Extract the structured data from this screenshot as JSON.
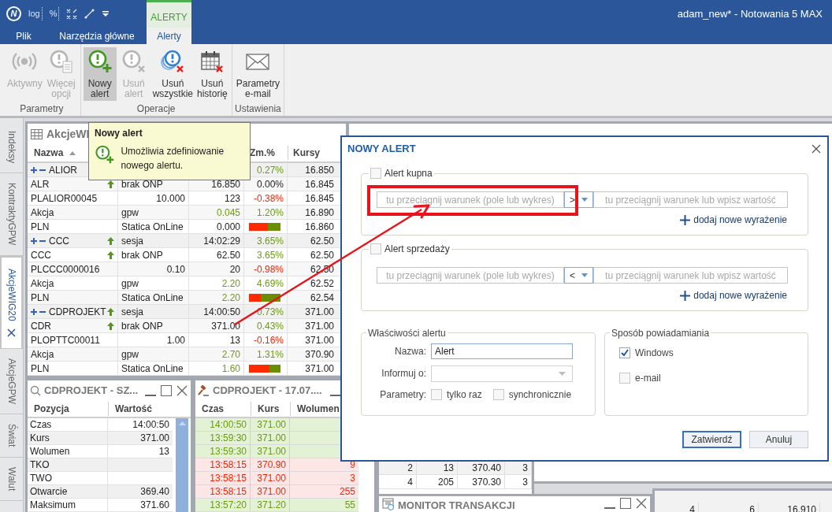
{
  "title_bar": {
    "quick_access": [
      {
        "kind": "logo",
        "label": "N"
      },
      {
        "kind": "scale",
        "label": "log"
      },
      {
        "kind": "scale",
        "label": "%"
      },
      {
        "kind": "cross"
      },
      {
        "kind": "line"
      },
      {
        "kind": "dropdown"
      }
    ],
    "context_tab": "ALERTY",
    "title": "adam_new* - Notowania 5 MAX"
  },
  "tabs": [
    {
      "label": "Plik",
      "selected": false
    },
    {
      "label": "Narzędzia główne",
      "selected": false
    },
    {
      "label": "Alerty",
      "selected": true
    }
  ],
  "ribbon": {
    "groups": [
      {
        "label": "Parametry",
        "buttons": [
          {
            "lines": [
              "Aktywny"
            ],
            "disabled": true,
            "selected": false
          },
          {
            "lines": [
              "Więcej",
              "opcji"
            ],
            "disabled": true,
            "selected": false
          }
        ]
      },
      {
        "label": "Operacje",
        "buttons": [
          {
            "lines": [
              "Nowy",
              "alert"
            ],
            "disabled": false,
            "selected": true
          },
          {
            "lines": [
              "Usuń",
              "alert"
            ],
            "disabled": true,
            "selected": false
          },
          {
            "lines": [
              "Usuń",
              "wszystkie"
            ],
            "disabled": false,
            "selected": false
          },
          {
            "lines": [
              "Usuń",
              "historię"
            ],
            "disabled": false,
            "selected": false
          }
        ]
      },
      {
        "label": "Ustawienia",
        "buttons": [
          {
            "lines": [
              "Parametry",
              "e-mail"
            ],
            "disabled": false,
            "selected": false
          }
        ]
      }
    ]
  },
  "side_tabs": [
    {
      "label": "Indeksy",
      "selected": false
    },
    {
      "label": "KontraktyGPW",
      "selected": false
    },
    {
      "label": "AkcjeWIG20",
      "selected": true
    },
    {
      "label": "AkcjeGPW",
      "selected": false
    },
    {
      "label": "Świat",
      "selected": false
    },
    {
      "label": "Walut",
      "selected": false
    }
  ],
  "main_panel": {
    "title": "AkcjeWI",
    "columns": [
      {
        "label": "Nazwa",
        "sorted": true
      },
      {
        "label": "Zm.%"
      },
      {
        "label": "Kursy"
      }
    ],
    "rows": [
      {
        "kind": "group",
        "name": "ALIOR",
        "arrow": false,
        "change": "0.27%",
        "change_up": true,
        "change_down": false,
        "price": "16.850"
      },
      {
        "kind": "symbol",
        "name": "ALR",
        "arrow": true,
        "col2": "brak ONP",
        "col3": "16.850",
        "col3_up": false,
        "change": "0.00%",
        "change_up": false,
        "change_down": false,
        "price": "16.845"
      },
      {
        "kind": "isin",
        "name": "PLALIOR00045",
        "arrow": false,
        "col2": "10.000",
        "col3": "123",
        "col3_up": false,
        "change": "-0.38%",
        "change_up": false,
        "change_down": true,
        "price": "16.845"
      },
      {
        "kind": "type",
        "name": "Akcja",
        "arrow": false,
        "col2": "gpw",
        "col3": "0.045",
        "col3_up": true,
        "change": "1.20%",
        "change_up": true,
        "change_down": false,
        "price": "16.890"
      },
      {
        "kind": "currency",
        "name": "PLN",
        "arrow": false,
        "col2": "Statica OnLine",
        "col3": "0.000",
        "col3_up": false,
        "bar": {
          "level": 0.6
        },
        "price": "16.860"
      },
      {
        "kind": "group",
        "name": "CCC",
        "arrow": true,
        "col2": "sesja",
        "col3": "14:02:29",
        "col3_up": false,
        "change": "3.65%",
        "change_up": true,
        "change_down": false,
        "price": "62.50"
      },
      {
        "kind": "symbol",
        "name": "CCC",
        "arrow": true,
        "col2": "brak ONP",
        "col3": "62.50",
        "col3_up": false,
        "change": "3.65%",
        "change_up": true,
        "change_down": false,
        "price": "62.50"
      },
      {
        "kind": "isin",
        "name": "PLCCC0000016",
        "arrow": false,
        "col2": "0.10",
        "col3": "20",
        "col3_up": false,
        "change": "-0.98%",
        "change_up": false,
        "change_down": true,
        "price": "62.50"
      },
      {
        "kind": "type",
        "name": "Akcja",
        "arrow": false,
        "col2": "gpw",
        "col3": "2.20",
        "col3_up": true,
        "change": "4.69%",
        "change_up": true,
        "change_down": false,
        "price": "62.52"
      },
      {
        "kind": "currency",
        "name": "PLN",
        "arrow": false,
        "col2": "Statica OnLine",
        "col3": "2.20",
        "col3_up": true,
        "bar": {
          "level": 0.38
        },
        "price": "62.54"
      },
      {
        "kind": "group",
        "name": "CDPROJEKT",
        "arrow": true,
        "col2": "sesja",
        "col3": "14:00:50",
        "col3_up": false,
        "change": "0.73%",
        "change_up": true,
        "change_down": false,
        "price": "371.00"
      },
      {
        "kind": "symbol",
        "name": "CDR",
        "arrow": true,
        "col2": "brak ONP",
        "col3": "371.00",
        "col3_up": false,
        "change": "0.43%",
        "change_up": true,
        "change_down": false,
        "price": "371.00"
      },
      {
        "kind": "isin",
        "name": "PLOPTTC00011",
        "arrow": false,
        "col2": "1.00",
        "col3": "13",
        "col3_up": false,
        "change": "-0.16%",
        "change_up": false,
        "change_down": true,
        "price": "371.00"
      },
      {
        "kind": "type",
        "name": "Akcja",
        "arrow": false,
        "col2": "gpw",
        "col3": "2.70",
        "col3_up": true,
        "change": "1.31%",
        "change_up": true,
        "change_down": false,
        "price": "370.90"
      },
      {
        "kind": "currency",
        "name": "PLN",
        "arrow": false,
        "col2": "Statica OnLine",
        "col3": "1.60",
        "col3_up": true,
        "bar": {
          "level": 0.66
        },
        "price": "371.00"
      }
    ]
  },
  "tooltip": {
    "title": "Nowy alert",
    "text": "Umożliwia zdefiniowanie nowego alertu."
  },
  "detail_panel": {
    "title": "CDPROJEKT - SZ...",
    "columns": [
      "Pozycja",
      "Wartość"
    ],
    "rows": [
      [
        "Czas",
        "14:00:50"
      ],
      [
        "Kurs",
        "371.00"
      ],
      [
        "Wolumen",
        "13"
      ],
      [
        "TKO"
      ],
      [
        "TWO"
      ],
      [
        "Otwarcie",
        "369.40"
      ],
      [
        "Maksimum",
        "371.60"
      ]
    ]
  },
  "trades_panel": {
    "title": "CDPROJEKT - 17.07....",
    "columns": [
      "Czas",
      "Kurs",
      "Wolumen"
    ],
    "rows": [
      {
        "time": "14:00:50",
        "price": "371.00",
        "up": true
      },
      {
        "time": "13:59:30",
        "price": "371.00",
        "up": true
      },
      {
        "time": "13:59:30",
        "price": "371.00",
        "up": true
      },
      {
        "time": "13:58:15",
        "price": "370.90",
        "volume": "9",
        "up": false
      },
      {
        "time": "13:58:15",
        "price": "371.00",
        "volume": "3",
        "up": false
      },
      {
        "time": "13:58:15",
        "price": "371.00",
        "volume": "255",
        "up": false
      },
      {
        "time": "13:57:20",
        "price": "371.20",
        "volume": "55",
        "up": true
      }
    ]
  },
  "depth_panel": {
    "rows": [
      [
        "2",
        "13",
        "370.40",
        "3"
      ],
      [
        "4",
        "205",
        "370.30",
        "3"
      ]
    ]
  },
  "monitor_panel": {
    "title": "MONITOR TRANSAKCJI"
  },
  "quotes_panel": {
    "rows": [
      [
        "4",
        "6",
        "16.910"
      ]
    ]
  },
  "dialog": {
    "title": "NOWY ALERT",
    "sections": [
      {
        "label": "Alert kupna",
        "checked": false,
        "left_placeholder": "tu przeciągnij warunek (pole lub wykres)",
        "operator": ">",
        "right_placeholder": "tu przeciągnij warunek lub wpisz wartość",
        "add_link": "dodaj nowe wyrażenie",
        "highlighted": true
      },
      {
        "label": "Alert sprzedaży",
        "checked": false,
        "left_placeholder": "tu przeciągnij warunek (pole lub wykres)",
        "operator": "<",
        "right_placeholder": "tu przeciągnij warunek lub wpisz wartość",
        "add_link": "dodaj nowe wyrażenie",
        "highlighted": false
      }
    ],
    "properties": {
      "label": "Właściwości alertu",
      "name_label": "Nazwa:",
      "name_value": "Alert",
      "inform_label": "Informuj o:",
      "params_label": "Parametry:",
      "params": [
        {
          "label": "tylko raz",
          "checked": false
        },
        {
          "label": "synchronicznie",
          "checked": false
        }
      ]
    },
    "notification": {
      "label": "Sposób powiadamiania",
      "options": [
        {
          "label": "Windows",
          "checked": true
        },
        {
          "label": "e-mail",
          "checked": false
        }
      ]
    },
    "buttons": [
      {
        "label": "Zatwierdź",
        "default": true
      },
      {
        "label": "Anuluj",
        "default": false
      }
    ]
  }
}
